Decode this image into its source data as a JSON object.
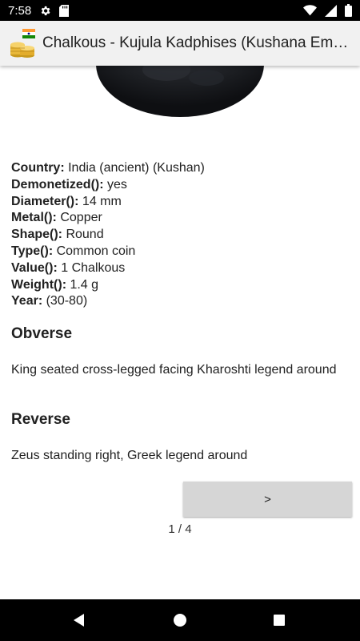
{
  "status_bar": {
    "time": "7:58",
    "left_icons": [
      "gear-icon",
      "sd-card-icon"
    ],
    "right_icons": [
      "wifi-icon",
      "cellular-signal-icon",
      "battery-icon"
    ]
  },
  "app_bar": {
    "icon": "coins-with-india-flag-icon",
    "title": "Chalkous - Kujula Kadphises (Kushana Em…"
  },
  "coin": {
    "details": [
      {
        "key": "Country:",
        "value": " India (ancient) (Kushan)"
      },
      {
        "key": "Demonetized():",
        "value": " yes"
      },
      {
        "key": "Diameter():",
        "value": " 14 mm"
      },
      {
        "key": "Metal():",
        "value": " Copper"
      },
      {
        "key": "Shape():",
        "value": " Round"
      },
      {
        "key": "Type():",
        "value": " Common coin"
      },
      {
        "key": "Value():",
        "value": " 1 Chalkous"
      },
      {
        "key": "Weight():",
        "value": " 1.4 g"
      },
      {
        "key": "Year:",
        "value": " (30-80)"
      }
    ],
    "obverse": {
      "heading": "Obverse",
      "text": "King seated cross-legged facing Kharoshti legend around"
    },
    "reverse": {
      "heading": "Reverse",
      "text": "Zeus standing right, Greek legend around"
    }
  },
  "pager": {
    "next_label": ">",
    "indicator": "1 / 4"
  },
  "nav_bar": {
    "buttons": [
      "back-icon",
      "home-icon",
      "recents-icon"
    ]
  }
}
